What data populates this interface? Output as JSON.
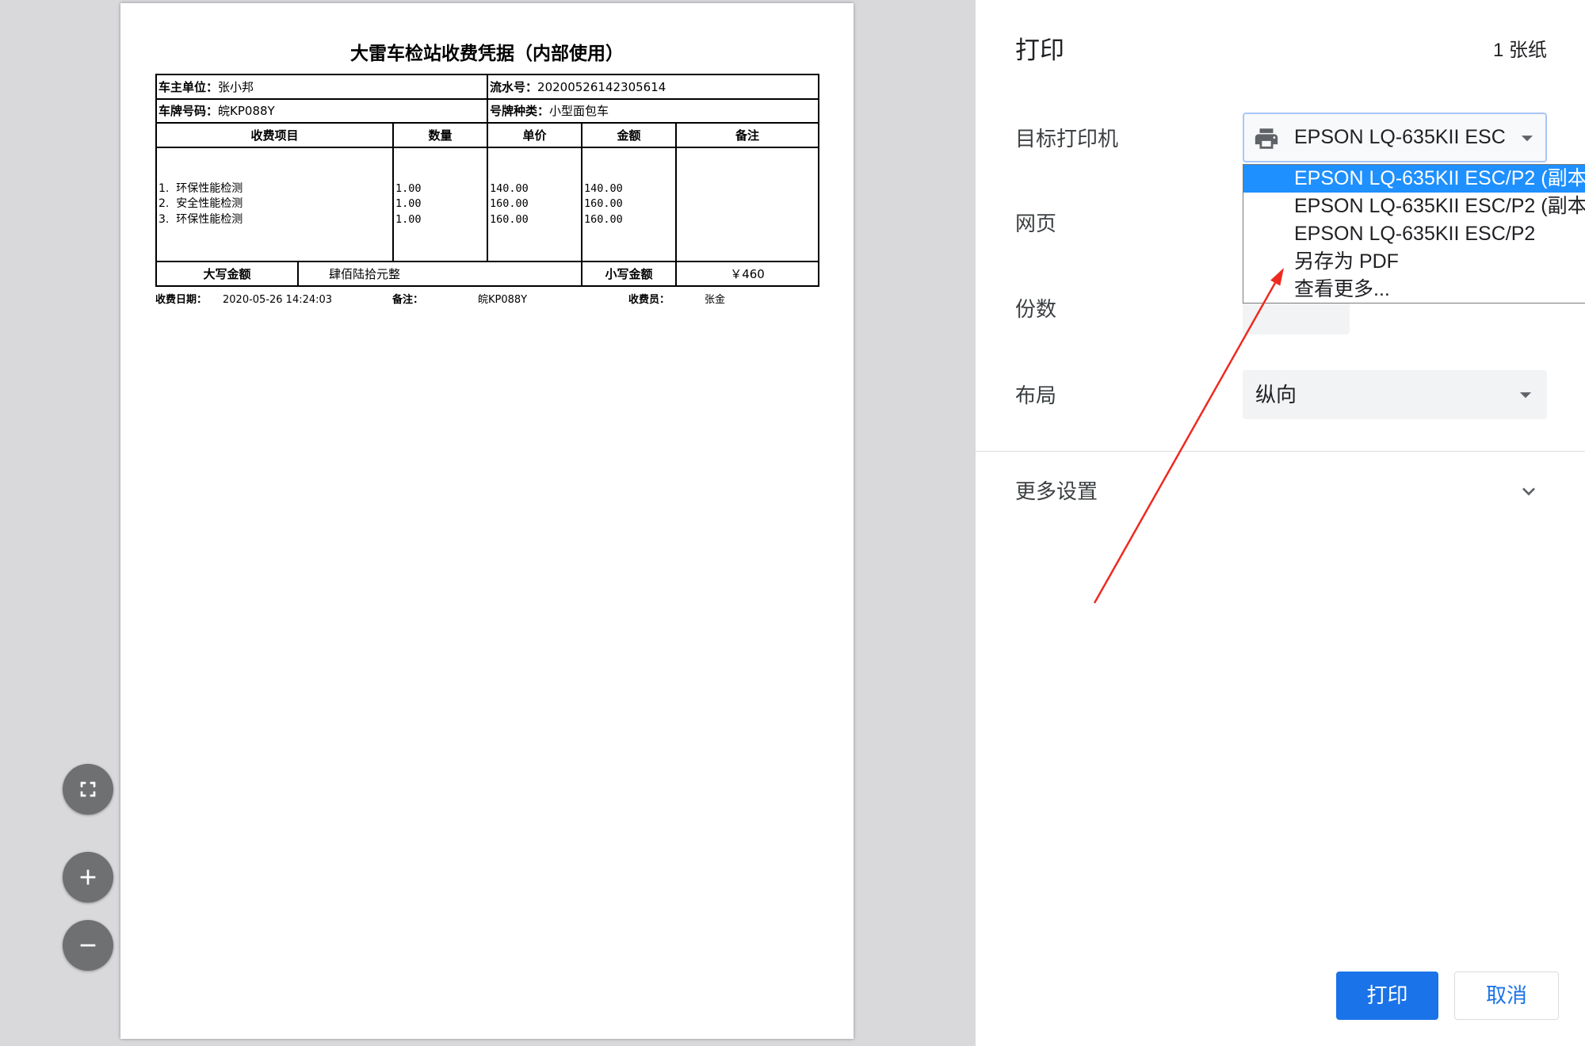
{
  "colors": {
    "accent": "#1a73e8",
    "option_highlight": "#1e90ff",
    "preview_background": "#d9d9dc",
    "zoom_button": "#6f7072",
    "field_background": "#f1f3f4",
    "annotation_arrow": "#ee2a1f"
  },
  "preview": {
    "receipt": {
      "title": "大雷车检站收费凭据（内部使用）",
      "owner_label": "车主单位：",
      "owner_value": "张小邦",
      "serial_label": "流水号：",
      "serial_value": "20200526142305614",
      "plate_label": "车牌号码：",
      "plate_value": "皖KP088Y",
      "plate_type_label": "号牌种类：",
      "plate_type_value": "小型面包车",
      "columns": [
        "收费项目",
        "数量",
        "单价",
        "金额",
        "备注"
      ],
      "items": [
        {
          "name": "1.  环保性能检测",
          "qty": "1.00",
          "price": "140.00",
          "amount": "140.00"
        },
        {
          "name": "2.  安全性能检测",
          "qty": "1.00",
          "price": "160.00",
          "amount": "160.00"
        },
        {
          "name": "3.  环保性能检测",
          "qty": "1.00",
          "price": "160.00",
          "amount": "160.00"
        }
      ],
      "total_upper_label": "大写金额",
      "total_upper_value": "肆佰陆拾元整",
      "total_lower_label": "小写金额",
      "total_lower_value": "￥460",
      "footer": {
        "date_label": "收费日期：",
        "date_value": "2020-05-26 14:24:03",
        "note_label": "备注：",
        "note_value": "皖KP088Y",
        "cashier_label": "收费员：",
        "cashier_value": "张金"
      }
    },
    "zoom_controls": [
      {
        "icon": "fit-to-page-icon"
      },
      {
        "icon": "zoom-in-icon"
      },
      {
        "icon": "zoom-out-icon"
      }
    ]
  },
  "settings": {
    "title": "打印",
    "sheet_count": "1 张纸",
    "destination": {
      "label": "目标打印机",
      "icon": "printer-icon",
      "selected": "EPSON LQ-635KII ESC",
      "options": [
        {
          "label": "EPSON LQ-635KII ESC/P2 (副本",
          "highlighted": true
        },
        {
          "label": "EPSON LQ-635KII ESC/P2 (副本",
          "highlighted": false
        },
        {
          "label": "EPSON LQ-635KII ESC/P2",
          "highlighted": false
        },
        {
          "label": "另存为 PDF",
          "highlighted": false
        },
        {
          "label": "查看更多...",
          "highlighted": false
        }
      ]
    },
    "pages": {
      "label": "网页"
    },
    "copies": {
      "label": "份数"
    },
    "layout": {
      "label": "布局",
      "selected": "纵向"
    },
    "more": {
      "label": "更多设置",
      "icon": "chevron-down-icon"
    }
  },
  "actions": {
    "print": "打印",
    "cancel": "取消"
  }
}
